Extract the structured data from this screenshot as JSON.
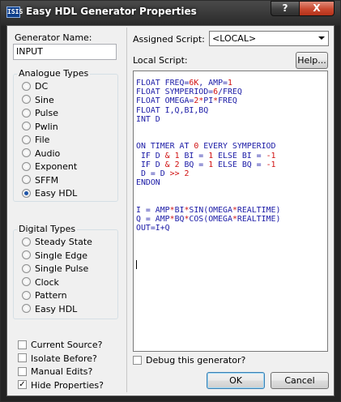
{
  "window": {
    "title": "Easy HDL Generator Properties",
    "app_icon_text": "ISIS",
    "help_glyph": "?",
    "close_glyph": "X"
  },
  "left": {
    "generator_name_label": "Generator Name:",
    "generator_name_value": "INPUT",
    "analogue_types": {
      "title": "Analogue Types",
      "items": [
        "DC",
        "Sine",
        "Pulse",
        "Pwlin",
        "File",
        "Audio",
        "Exponent",
        "SFFM",
        "Easy HDL"
      ],
      "selected": "Easy HDL"
    },
    "digital_types": {
      "title": "Digital Types",
      "items": [
        "Steady State",
        "Single Edge",
        "Single Pulse",
        "Clock",
        "Pattern",
        "Easy HDL"
      ]
    },
    "options": [
      {
        "label": "Current Source?",
        "checked": false
      },
      {
        "label": "Isolate Before?",
        "checked": false
      },
      {
        "label": "Manual Edits?",
        "checked": false
      },
      {
        "label": "Hide Properties?",
        "checked": true
      }
    ]
  },
  "right": {
    "assigned_script_label": "Assigned Script:",
    "assigned_script_value": "<LOCAL>",
    "local_script_label": "Local Script:",
    "help_button": "Help...",
    "debug_label": "Debug this generator?",
    "ok_button": "OK",
    "cancel_button": "Cancel"
  },
  "script_lines": [
    [
      [
        "FLOAT FREQ=",
        "t"
      ],
      [
        "6K",
        "n"
      ],
      [
        ", AMP=",
        "t"
      ],
      [
        "1",
        "n"
      ]
    ],
    [
      [
        "FLOAT SYMPERIOD=",
        "t"
      ],
      [
        "6",
        "n"
      ],
      [
        "/FREQ",
        "t"
      ]
    ],
    [
      [
        "FLOAT OMEGA=",
        "t"
      ],
      [
        "2",
        "n"
      ],
      [
        "*",
        "o"
      ],
      [
        "PI",
        "t"
      ],
      [
        "*",
        "o"
      ],
      [
        "FREQ",
        "t"
      ]
    ],
    [
      [
        "FLOAT I,Q,BI,BQ",
        "t"
      ]
    ],
    [
      [
        "INT D",
        "t"
      ]
    ],
    [],
    [],
    [
      [
        "ON TIMER AT ",
        "t"
      ],
      [
        "0",
        "n"
      ],
      [
        " EVERY SYMPERIOD",
        "t"
      ]
    ],
    [
      [
        " IF D ",
        "t"
      ],
      [
        "&",
        "o"
      ],
      [
        " ",
        "t"
      ],
      [
        "1",
        "n"
      ],
      [
        " BI = ",
        "t"
      ],
      [
        "1",
        "n"
      ],
      [
        " ELSE BI = ",
        "t"
      ],
      [
        "-1",
        "n"
      ]
    ],
    [
      [
        " IF D ",
        "t"
      ],
      [
        "&",
        "o"
      ],
      [
        " ",
        "t"
      ],
      [
        "2",
        "n"
      ],
      [
        " BQ = ",
        "t"
      ],
      [
        "1",
        "n"
      ],
      [
        " ELSE BQ = ",
        "t"
      ],
      [
        "-1",
        "n"
      ]
    ],
    [
      [
        " D = D ",
        ""
      ],
      [
        ">>",
        "o"
      ],
      [
        " ",
        "t"
      ],
      [
        "2",
        "n"
      ]
    ],
    [
      [
        "ENDON",
        "t"
      ]
    ],
    [],
    [],
    [
      [
        "I = AMP",
        "t"
      ],
      [
        "*",
        "o"
      ],
      [
        "BI",
        "t"
      ],
      [
        "*",
        "o"
      ],
      [
        "SIN(OMEGA",
        "t"
      ],
      [
        "*",
        "o"
      ],
      [
        "REALTIME)",
        "t"
      ]
    ],
    [
      [
        "Q = AMP",
        "t"
      ],
      [
        "*",
        "o"
      ],
      [
        "BQ",
        "t"
      ],
      [
        "*",
        "o"
      ],
      [
        "COS(OMEGA",
        "t"
      ],
      [
        "*",
        "o"
      ],
      [
        "REALTIME)",
        "t"
      ]
    ],
    [
      [
        "OUT=I+Q",
        "t"
      ]
    ]
  ]
}
